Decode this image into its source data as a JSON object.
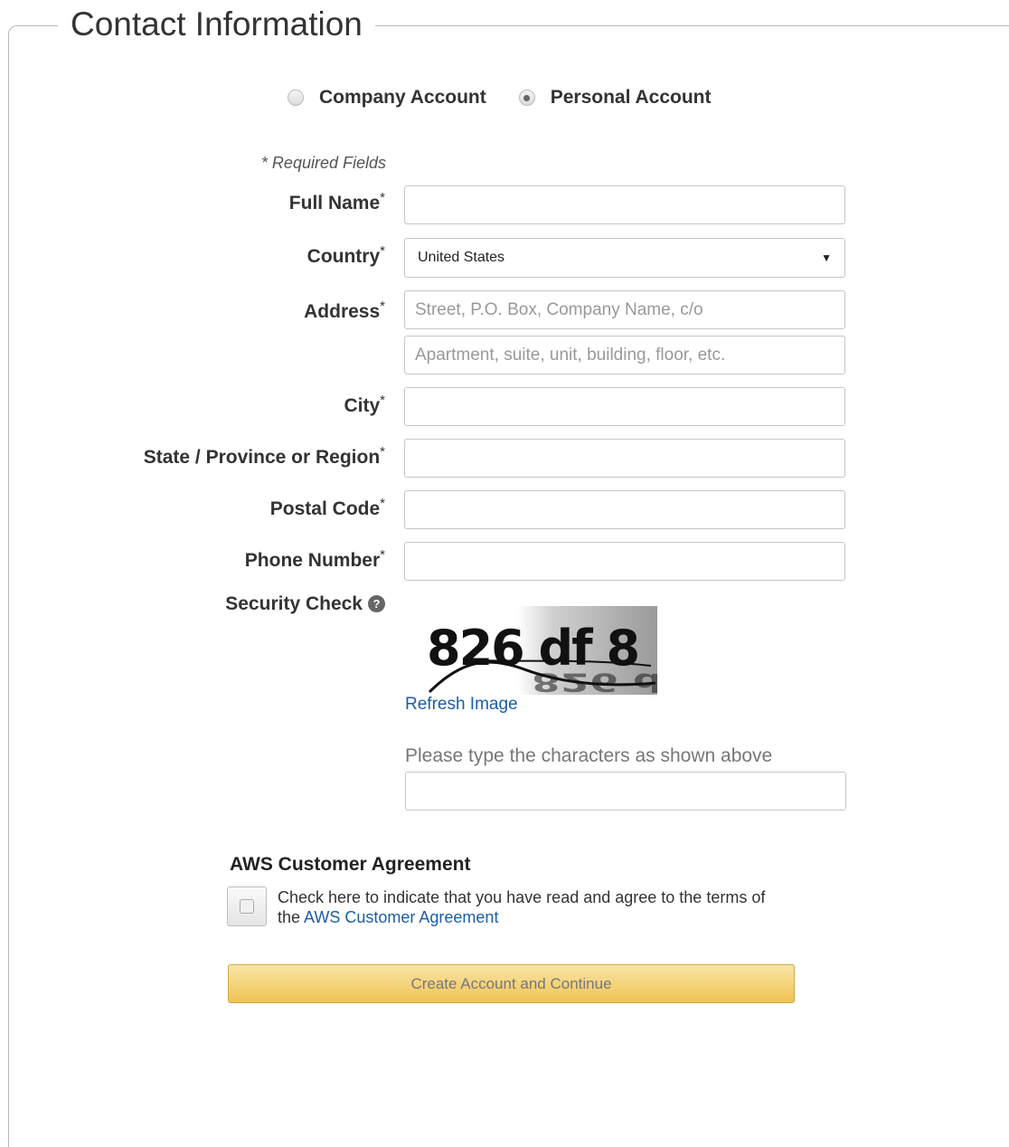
{
  "section": {
    "title": "Contact Information"
  },
  "account_type": {
    "options": [
      {
        "label": "Company Account",
        "selected": false
      },
      {
        "label": "Personal Account",
        "selected": true
      }
    ]
  },
  "form": {
    "required_note": "* Required Fields",
    "required_mark": "*",
    "full_name": {
      "label": "Full Name",
      "value": ""
    },
    "country": {
      "label": "Country",
      "value": "United States"
    },
    "address": {
      "label": "Address",
      "line1_placeholder": "Street, P.O. Box, Company Name, c/o",
      "line2_placeholder": "Apartment, suite, unit, building, floor, etc."
    },
    "city": {
      "label": "City",
      "value": ""
    },
    "state": {
      "label": "State / Province or Region",
      "value": ""
    },
    "postal_code": {
      "label": "Postal Code",
      "value": ""
    },
    "phone": {
      "label": "Phone Number",
      "value": ""
    }
  },
  "security": {
    "label": "Security Check",
    "help_glyph": "?",
    "captcha_text": "826 df 8",
    "refresh_label": "Refresh Image",
    "prompt": "Please type the characters as shown above",
    "value": ""
  },
  "agreement": {
    "title": "AWS Customer Agreement",
    "text_before": "Check here to indicate that you have read and agree to the terms of the ",
    "link_text": "AWS Customer Agreement",
    "checked": false
  },
  "submit_label": "Create Account and Continue",
  "colors": {
    "link": "#1a5ea8",
    "button_top": "#f9e4a6",
    "button_bottom": "#f0c453"
  }
}
